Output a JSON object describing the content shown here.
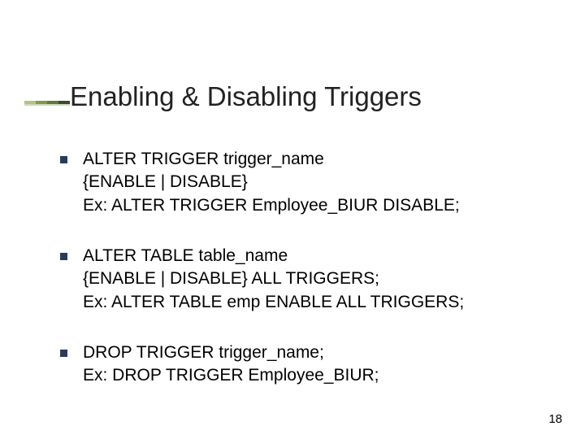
{
  "title": "Enabling & Disabling Triggers",
  "bullets": [
    {
      "l1": "ALTER TRIGGER trigger_name",
      "l2": "{ENABLE | DISABLE}",
      "l3": "Ex: ALTER TRIGGER Employee_BIUR DISABLE;"
    },
    {
      "l1": "ALTER TABLE table_name",
      "l2": "{ENABLE | DISABLE} ALL TRIGGERS;",
      "l3": "Ex: ALTER TABLE emp ENABLE ALL TRIGGERS;"
    },
    {
      "l1": "DROP TRIGGER trigger_name;",
      "l2": "Ex: DROP TRIGGER Employee_BIUR;"
    }
  ],
  "page_number": "18"
}
